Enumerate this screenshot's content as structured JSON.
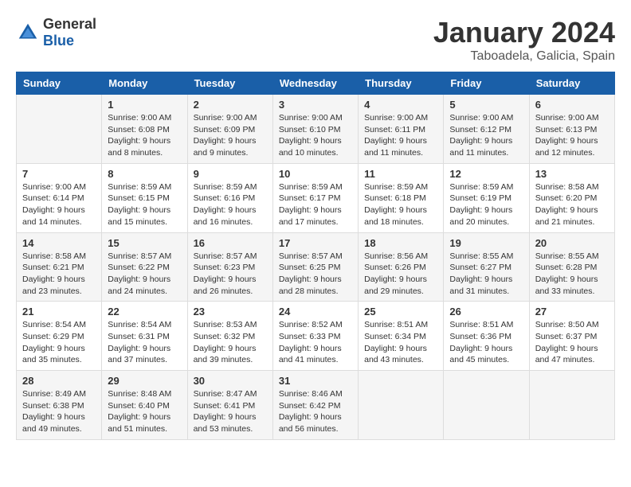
{
  "logo": {
    "general": "General",
    "blue": "Blue"
  },
  "header": {
    "title": "January 2024",
    "subtitle": "Taboadela, Galicia, Spain"
  },
  "days_of_week": [
    "Sunday",
    "Monday",
    "Tuesday",
    "Wednesday",
    "Thursday",
    "Friday",
    "Saturday"
  ],
  "weeks": [
    [
      {
        "day": "",
        "sunrise": "",
        "sunset": "",
        "daylight": ""
      },
      {
        "day": "1",
        "sunrise": "Sunrise: 9:00 AM",
        "sunset": "Sunset: 6:08 PM",
        "daylight": "Daylight: 9 hours and 8 minutes."
      },
      {
        "day": "2",
        "sunrise": "Sunrise: 9:00 AM",
        "sunset": "Sunset: 6:09 PM",
        "daylight": "Daylight: 9 hours and 9 minutes."
      },
      {
        "day": "3",
        "sunrise": "Sunrise: 9:00 AM",
        "sunset": "Sunset: 6:10 PM",
        "daylight": "Daylight: 9 hours and 10 minutes."
      },
      {
        "day": "4",
        "sunrise": "Sunrise: 9:00 AM",
        "sunset": "Sunset: 6:11 PM",
        "daylight": "Daylight: 9 hours and 11 minutes."
      },
      {
        "day": "5",
        "sunrise": "Sunrise: 9:00 AM",
        "sunset": "Sunset: 6:12 PM",
        "daylight": "Daylight: 9 hours and 11 minutes."
      },
      {
        "day": "6",
        "sunrise": "Sunrise: 9:00 AM",
        "sunset": "Sunset: 6:13 PM",
        "daylight": "Daylight: 9 hours and 12 minutes."
      }
    ],
    [
      {
        "day": "7",
        "sunrise": "Sunrise: 9:00 AM",
        "sunset": "Sunset: 6:14 PM",
        "daylight": "Daylight: 9 hours and 14 minutes."
      },
      {
        "day": "8",
        "sunrise": "Sunrise: 8:59 AM",
        "sunset": "Sunset: 6:15 PM",
        "daylight": "Daylight: 9 hours and 15 minutes."
      },
      {
        "day": "9",
        "sunrise": "Sunrise: 8:59 AM",
        "sunset": "Sunset: 6:16 PM",
        "daylight": "Daylight: 9 hours and 16 minutes."
      },
      {
        "day": "10",
        "sunrise": "Sunrise: 8:59 AM",
        "sunset": "Sunset: 6:17 PM",
        "daylight": "Daylight: 9 hours and 17 minutes."
      },
      {
        "day": "11",
        "sunrise": "Sunrise: 8:59 AM",
        "sunset": "Sunset: 6:18 PM",
        "daylight": "Daylight: 9 hours and 18 minutes."
      },
      {
        "day": "12",
        "sunrise": "Sunrise: 8:59 AM",
        "sunset": "Sunset: 6:19 PM",
        "daylight": "Daylight: 9 hours and 20 minutes."
      },
      {
        "day": "13",
        "sunrise": "Sunrise: 8:58 AM",
        "sunset": "Sunset: 6:20 PM",
        "daylight": "Daylight: 9 hours and 21 minutes."
      }
    ],
    [
      {
        "day": "14",
        "sunrise": "Sunrise: 8:58 AM",
        "sunset": "Sunset: 6:21 PM",
        "daylight": "Daylight: 9 hours and 23 minutes."
      },
      {
        "day": "15",
        "sunrise": "Sunrise: 8:57 AM",
        "sunset": "Sunset: 6:22 PM",
        "daylight": "Daylight: 9 hours and 24 minutes."
      },
      {
        "day": "16",
        "sunrise": "Sunrise: 8:57 AM",
        "sunset": "Sunset: 6:23 PM",
        "daylight": "Daylight: 9 hours and 26 minutes."
      },
      {
        "day": "17",
        "sunrise": "Sunrise: 8:57 AM",
        "sunset": "Sunset: 6:25 PM",
        "daylight": "Daylight: 9 hours and 28 minutes."
      },
      {
        "day": "18",
        "sunrise": "Sunrise: 8:56 AM",
        "sunset": "Sunset: 6:26 PM",
        "daylight": "Daylight: 9 hours and 29 minutes."
      },
      {
        "day": "19",
        "sunrise": "Sunrise: 8:55 AM",
        "sunset": "Sunset: 6:27 PM",
        "daylight": "Daylight: 9 hours and 31 minutes."
      },
      {
        "day": "20",
        "sunrise": "Sunrise: 8:55 AM",
        "sunset": "Sunset: 6:28 PM",
        "daylight": "Daylight: 9 hours and 33 minutes."
      }
    ],
    [
      {
        "day": "21",
        "sunrise": "Sunrise: 8:54 AM",
        "sunset": "Sunset: 6:29 PM",
        "daylight": "Daylight: 9 hours and 35 minutes."
      },
      {
        "day": "22",
        "sunrise": "Sunrise: 8:54 AM",
        "sunset": "Sunset: 6:31 PM",
        "daylight": "Daylight: 9 hours and 37 minutes."
      },
      {
        "day": "23",
        "sunrise": "Sunrise: 8:53 AM",
        "sunset": "Sunset: 6:32 PM",
        "daylight": "Daylight: 9 hours and 39 minutes."
      },
      {
        "day": "24",
        "sunrise": "Sunrise: 8:52 AM",
        "sunset": "Sunset: 6:33 PM",
        "daylight": "Daylight: 9 hours and 41 minutes."
      },
      {
        "day": "25",
        "sunrise": "Sunrise: 8:51 AM",
        "sunset": "Sunset: 6:34 PM",
        "daylight": "Daylight: 9 hours and 43 minutes."
      },
      {
        "day": "26",
        "sunrise": "Sunrise: 8:51 AM",
        "sunset": "Sunset: 6:36 PM",
        "daylight": "Daylight: 9 hours and 45 minutes."
      },
      {
        "day": "27",
        "sunrise": "Sunrise: 8:50 AM",
        "sunset": "Sunset: 6:37 PM",
        "daylight": "Daylight: 9 hours and 47 minutes."
      }
    ],
    [
      {
        "day": "28",
        "sunrise": "Sunrise: 8:49 AM",
        "sunset": "Sunset: 6:38 PM",
        "daylight": "Daylight: 9 hours and 49 minutes."
      },
      {
        "day": "29",
        "sunrise": "Sunrise: 8:48 AM",
        "sunset": "Sunset: 6:40 PM",
        "daylight": "Daylight: 9 hours and 51 minutes."
      },
      {
        "day": "30",
        "sunrise": "Sunrise: 8:47 AM",
        "sunset": "Sunset: 6:41 PM",
        "daylight": "Daylight: 9 hours and 53 minutes."
      },
      {
        "day": "31",
        "sunrise": "Sunrise: 8:46 AM",
        "sunset": "Sunset: 6:42 PM",
        "daylight": "Daylight: 9 hours and 56 minutes."
      },
      {
        "day": "",
        "sunrise": "",
        "sunset": "",
        "daylight": ""
      },
      {
        "day": "",
        "sunrise": "",
        "sunset": "",
        "daylight": ""
      },
      {
        "day": "",
        "sunrise": "",
        "sunset": "",
        "daylight": ""
      }
    ]
  ]
}
